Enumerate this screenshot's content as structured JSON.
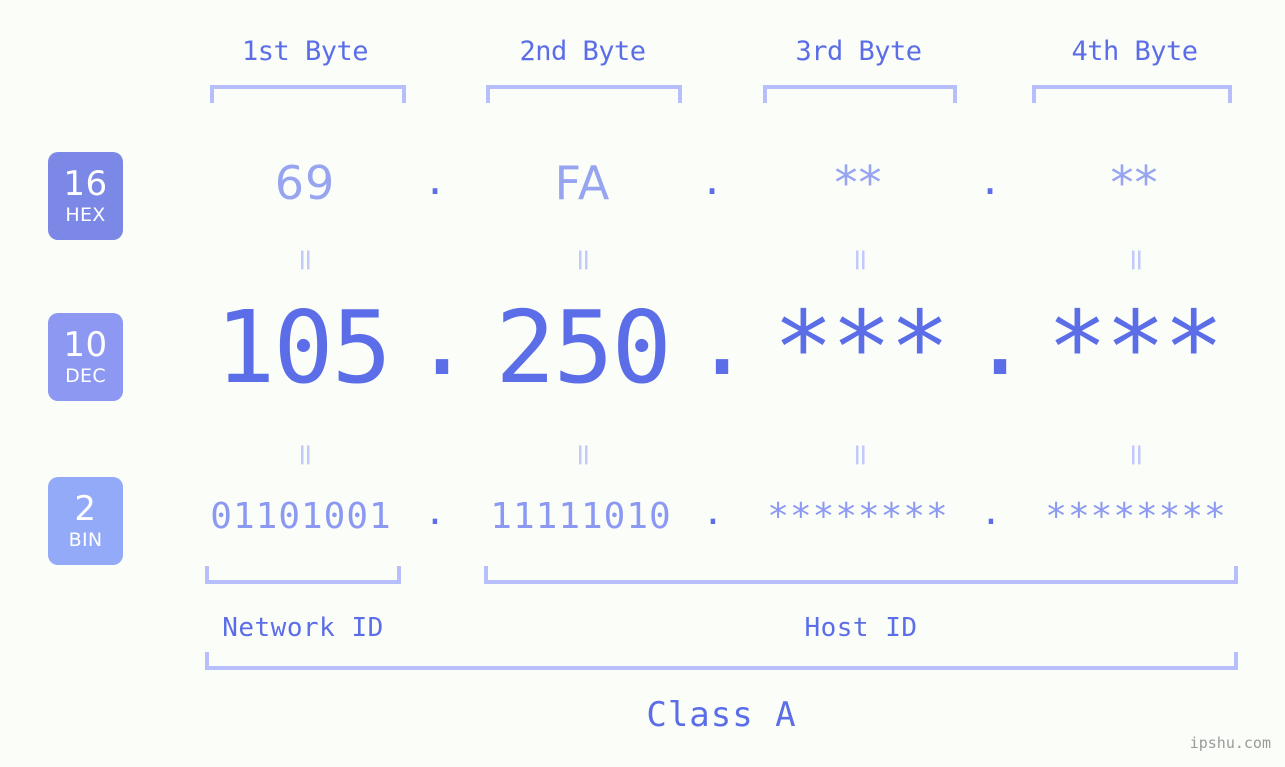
{
  "background_color": "#fbfdf8",
  "accent_color": "#5b6ee8",
  "bracket_color": "#b6befc",
  "byte_headers": [
    {
      "label": "1st Byte"
    },
    {
      "label": "2nd Byte"
    },
    {
      "label": "3rd Byte"
    },
    {
      "label": "4th Byte"
    }
  ],
  "bases": [
    {
      "num": "16",
      "sys": "HEX",
      "color": "#7b88e6"
    },
    {
      "num": "10",
      "sys": "DEC",
      "color": "#8c98f2"
    },
    {
      "num": "2",
      "sys": "BIN",
      "color": "#93aaf9"
    }
  ],
  "rows": {
    "hex": {
      "base_label": "16",
      "base_system": "HEX",
      "values": [
        "69",
        "FA",
        "**",
        "**"
      ],
      "separator": "."
    },
    "dec": {
      "base_label": "10",
      "base_system": "DEC",
      "values": [
        "105",
        "250",
        "***",
        "***"
      ],
      "separator": "."
    },
    "bin": {
      "base_label": "2",
      "base_system": "BIN",
      "values": [
        "01101001",
        "11111010",
        "********",
        "********"
      ],
      "separator": "."
    }
  },
  "equals_glyph": "=",
  "segments": {
    "network_id": "Network ID",
    "host_id": "Host ID",
    "ip_class": "Class A"
  },
  "watermark": "ipshu.com"
}
